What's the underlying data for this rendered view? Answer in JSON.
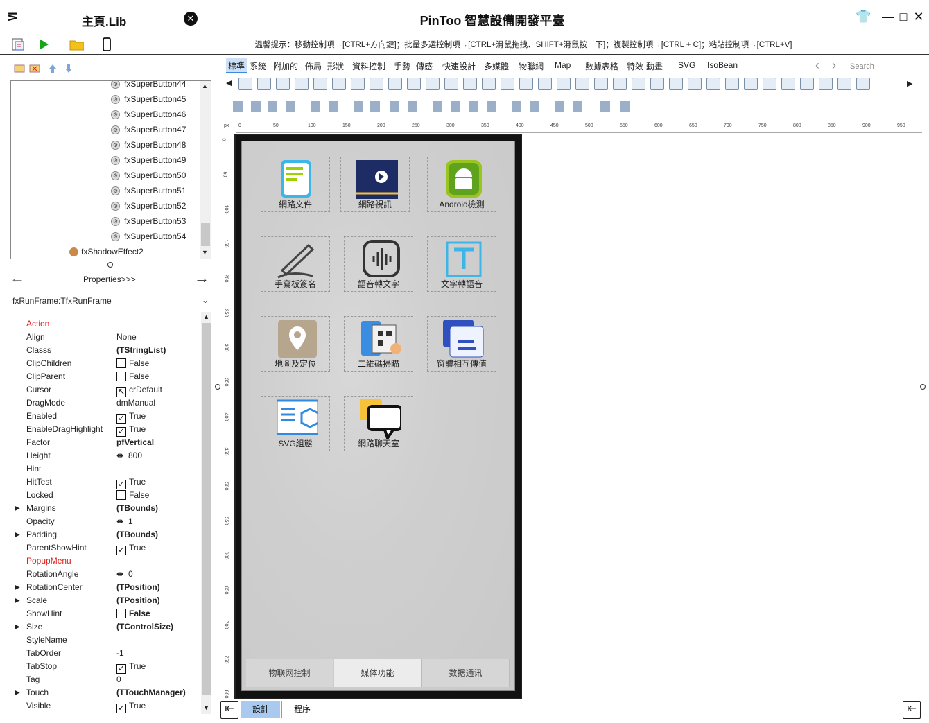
{
  "titlebar": {
    "lib_title": "主頁.Lib",
    "app_title": "PinToo 智慧設備開發平臺",
    "close_lib": "✕",
    "menu_glyph": "⋝",
    "win_buttons": [
      "👕",
      "—",
      "□",
      "✕"
    ]
  },
  "hint": "溫馨提示：移動控制項→[CTRL+方向鍵]；批量多選控制項→[CTRL+滑鼠拖拽、SHIFT+滑鼠按一下]；複製控制項→[CTRL + C]；粘貼控制項→[CTRL+V]",
  "tree": {
    "items": [
      "fxSuperButton44",
      "fxSuperButton45",
      "fxSuperButton46",
      "fxSuperButton47",
      "fxSuperButton48",
      "fxSuperButton49",
      "fxSuperButton50",
      "fxSuperButton51",
      "fxSuperButton52",
      "fxSuperButton53",
      "fxSuperButton54"
    ],
    "last_item": "fxShadowEffect2"
  },
  "props_nav": {
    "label": "Properties>>>",
    "left_arrow": "←",
    "right_arrow": "→"
  },
  "object_select": "fxRunFrame:TfxRunFrame",
  "properties": [
    {
      "name": "Action",
      "value": "",
      "red": true
    },
    {
      "name": "Align",
      "value": "None"
    },
    {
      "name": "Classs",
      "value": "(TStringList)",
      "bold": true
    },
    {
      "name": "ClipChildren",
      "value": "False",
      "check": false
    },
    {
      "name": "ClipParent",
      "value": "False",
      "check": false
    },
    {
      "name": "Cursor",
      "value": "crDefault",
      "cursor": true
    },
    {
      "name": "DragMode",
      "value": "dmManual"
    },
    {
      "name": "Enabled",
      "value": "True",
      "check": true
    },
    {
      "name": "EnableDragHighlight",
      "value": "True",
      "check": true
    },
    {
      "name": "Factor",
      "value": "pfVertical",
      "bold": true
    },
    {
      "name": "Height",
      "value": "800",
      "spin": true
    },
    {
      "name": "Hint",
      "value": ""
    },
    {
      "name": "HitTest",
      "value": "True",
      "check": true
    },
    {
      "name": "Locked",
      "value": "False",
      "check": false
    },
    {
      "name": "Margins",
      "value": "(TBounds)",
      "bold": true,
      "expand": true
    },
    {
      "name": "Opacity",
      "value": "1",
      "spin": true
    },
    {
      "name": "Padding",
      "value": "(TBounds)",
      "bold": true,
      "expand": true
    },
    {
      "name": "ParentShowHint",
      "value": "True",
      "check": true
    },
    {
      "name": "PopupMenu",
      "value": "",
      "red": true
    },
    {
      "name": "RotationAngle",
      "value": "0",
      "spin": true
    },
    {
      "name": "RotationCenter",
      "value": "(TPosition)",
      "bold": true,
      "expand": true
    },
    {
      "name": "Scale",
      "value": "(TPosition)",
      "bold": true,
      "expand": true
    },
    {
      "name": "ShowHint",
      "value": "False",
      "check": false,
      "bold": true
    },
    {
      "name": "Size",
      "value": "(TControlSize)",
      "bold": true,
      "expand": true
    },
    {
      "name": "StyleName",
      "value": ""
    },
    {
      "name": "TabOrder",
      "value": "-1"
    },
    {
      "name": "TabStop",
      "value": "True",
      "check": true
    },
    {
      "name": "Tag",
      "value": "0"
    },
    {
      "name": "Touch",
      "value": "(TTouchManager)",
      "bold": true,
      "expand": true
    },
    {
      "name": "Visible",
      "value": "True",
      "check": true
    }
  ],
  "palette_tabs": [
    "標準",
    "系統",
    "附加的",
    "佈局",
    "形狀",
    "資料控制",
    "手勢",
    "傳感",
    "快速設計",
    "多媒體",
    "物聯網",
    "Map",
    "數據表格",
    "特效",
    "動畫",
    "SVG",
    "IsoBean"
  ],
  "search_placeholder": "Search",
  "ruler_top": [
    "px",
    "0",
    "50",
    "100",
    "150",
    "200",
    "250",
    "300",
    "350",
    "400",
    "450",
    "500",
    "550",
    "600",
    "650",
    "700",
    "750",
    "800",
    "850",
    "900",
    "950"
  ],
  "ruler_left": [
    "0",
    "50",
    "100",
    "150",
    "200",
    "250",
    "300",
    "350",
    "400",
    "450",
    "500",
    "550",
    "600",
    "650",
    "700",
    "750",
    "800"
  ],
  "tiles": [
    {
      "label": "網路文件",
      "icon": "document-icon"
    },
    {
      "label": "網路視訊",
      "icon": "video-icon"
    },
    {
      "label": "Android檢測",
      "icon": "android-icon"
    },
    {
      "label": "手寫板簽名",
      "icon": "pen-icon"
    },
    {
      "label": "語音轉文字",
      "icon": "voice-icon"
    },
    {
      "label": "文字轉語音",
      "icon": "text-icon"
    },
    {
      "label": "地圖及定位",
      "icon": "location-icon"
    },
    {
      "label": "二維碼掃瞄",
      "icon": "qrcode-icon"
    },
    {
      "label": "窗體相互傳值",
      "icon": "windows-icon"
    },
    {
      "label": "SVG組態",
      "icon": "svg-config-icon"
    },
    {
      "label": "網路聊天室",
      "icon": "chat-icon"
    }
  ],
  "bottom_tabs": [
    "物联网控制",
    "媒体功能",
    "数据通讯"
  ],
  "bottom_bar": {
    "design": "設計",
    "code": "程序"
  },
  "colors": {
    "accent": "#3b8ae0",
    "active_tab_bg": "#cce0f7",
    "red": "#e0201b"
  }
}
